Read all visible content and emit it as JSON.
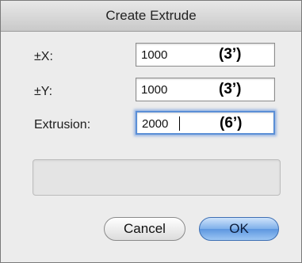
{
  "dialog": {
    "title": "Create Extrude"
  },
  "fields": {
    "x": {
      "label": "±X:",
      "value": "1000",
      "annotation": "(3’)"
    },
    "y": {
      "label": "±Y:",
      "value": "1000",
      "annotation": "(3’)"
    },
    "extrusion": {
      "label": "Extrusion:",
      "value": "2000",
      "annotation": "(6’)"
    }
  },
  "buttons": {
    "cancel_label": "Cancel",
    "ok_label": "OK"
  }
}
